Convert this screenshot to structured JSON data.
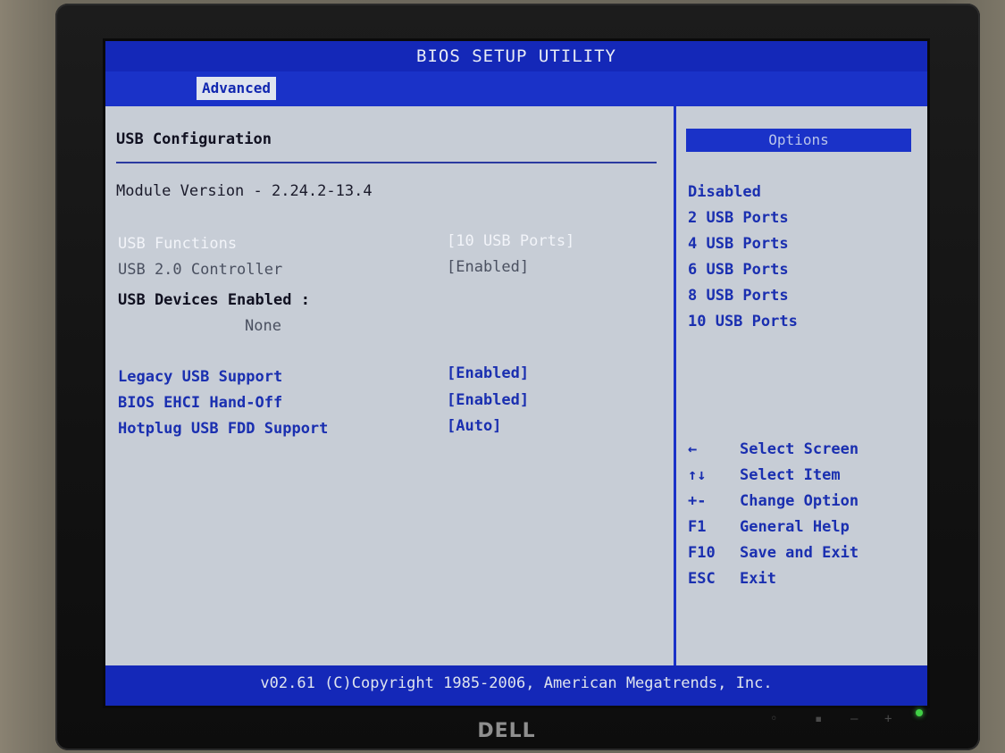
{
  "window": {
    "title": "BIOS SETUP UTILITY"
  },
  "tabs": [
    {
      "label": "Advanced",
      "active": true
    }
  ],
  "main": {
    "section_title": "USB Configuration",
    "module_version": "Module Version - 2.24.2-13.4",
    "items": [
      {
        "label": "USB Functions",
        "value": "[10 USB Ports]",
        "state": "selected"
      },
      {
        "label": "USB 2.0 Controller",
        "value": "[Enabled]",
        "state": "disabled"
      },
      {
        "label": "USB Devices Enabled :",
        "value": "",
        "state": "info"
      },
      {
        "label": "None",
        "value": "",
        "state": "info-value"
      },
      {
        "label": "Legacy USB Support",
        "value": "[Enabled]",
        "state": "normal"
      },
      {
        "label": "BIOS EHCI Hand-Off",
        "value": "[Enabled]",
        "state": "normal"
      },
      {
        "label": "Hotplug USB FDD Support",
        "value": "[Auto]",
        "state": "normal"
      }
    ]
  },
  "options_panel": {
    "title": "Options",
    "options": [
      "Disabled",
      "2 USB Ports",
      "4 USB Ports",
      "6 USB Ports",
      "8 USB Ports",
      "10 USB Ports"
    ]
  },
  "help_keys": [
    {
      "key": "←",
      "desc": "Select Screen"
    },
    {
      "key": "↑↓",
      "desc": "Select Item"
    },
    {
      "key": "+-",
      "desc": "Change Option"
    },
    {
      "key": "F1",
      "desc": "General Help"
    },
    {
      "key": "F10",
      "desc": "Save and Exit"
    },
    {
      "key": "ESC",
      "desc": "Exit"
    }
  ],
  "footer": {
    "copyright": "v02.61 (C)Copyright 1985-2006, American Megatrends, Inc."
  },
  "monitor": {
    "brand": "DELL"
  },
  "colors": {
    "bios_blue": "#1a32c8",
    "screen_bg": "#c7cdd6",
    "power_led": "#41d046"
  }
}
